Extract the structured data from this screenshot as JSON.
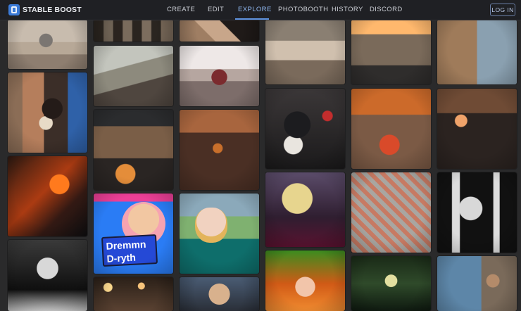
{
  "brand": {
    "name": "STABLE BOOST",
    "logo_icon": "stable-boost-logo-icon"
  },
  "nav": {
    "items": [
      {
        "label": "CREATE"
      },
      {
        "label": "EDIT"
      },
      {
        "label": "EXPLORE",
        "active": true
      },
      {
        "label": "PHOTOBOOTH"
      },
      {
        "label": "HISTORY"
      },
      {
        "label": "DISCORD"
      }
    ],
    "login": "LOG IN"
  },
  "tiles": [
    {
      "name": "gallery-image-desert-sphere"
    },
    {
      "name": "gallery-image-dog-chair"
    },
    {
      "name": "gallery-image-phoenix"
    },
    {
      "name": "gallery-image-woman-bw"
    },
    {
      "name": "gallery-image-columns"
    },
    {
      "name": "gallery-image-pyramid-a"
    },
    {
      "name": "gallery-image-pyramid-b"
    },
    {
      "name": "gallery-image-alien-creature"
    },
    {
      "name": "gallery-image-fortress-night"
    },
    {
      "name": "gallery-image-pyramid-fire"
    },
    {
      "name": "gallery-image-poster"
    },
    {
      "name": "gallery-image-train-woman"
    },
    {
      "name": "gallery-image-lamps"
    },
    {
      "name": "gallery-image-man"
    },
    {
      "name": "gallery-image-ships"
    },
    {
      "name": "gallery-image-dog-christmas"
    },
    {
      "name": "gallery-image-blonde-latex"
    },
    {
      "name": "gallery-image-redhead"
    },
    {
      "name": "gallery-image-temple-orange"
    },
    {
      "name": "gallery-image-dragon-map"
    },
    {
      "name": "gallery-image-forest"
    },
    {
      "name": "gallery-image-pyramids-grid"
    },
    {
      "name": "gallery-image-pyramid-moon"
    },
    {
      "name": "gallery-image-tree-fire"
    },
    {
      "name": "gallery-image-temple-dark"
    },
    {
      "name": "gallery-image-blonde-bw"
    },
    {
      "name": "gallery-image-aquarium"
    }
  ],
  "poster_text": [
    "Dremmn",
    "D-ryth"
  ]
}
